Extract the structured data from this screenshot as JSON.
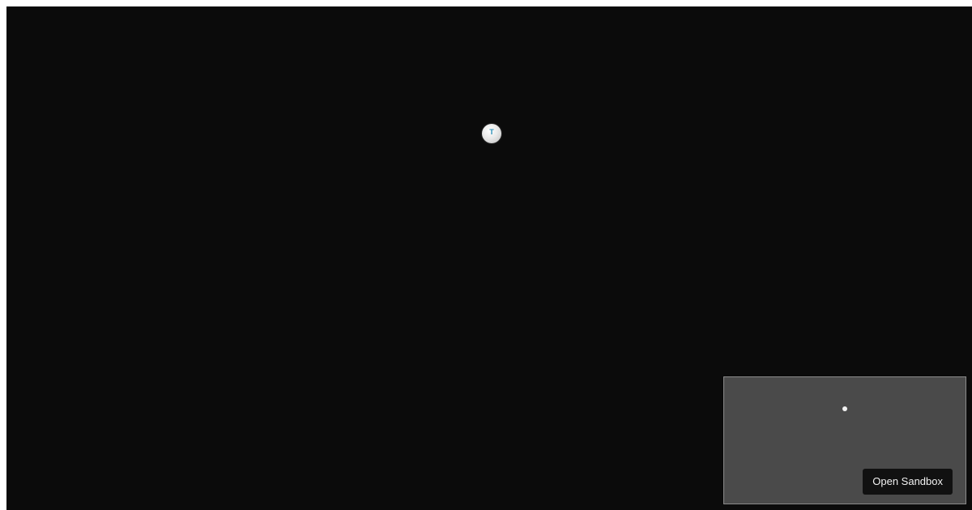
{
  "scene": {
    "background_color": "#0b0b0b",
    "ball": {
      "letter": "T",
      "letter_color": "#2a8fb8"
    }
  },
  "minimap": {
    "background_color": "#4a4a4a",
    "dot_color": "#f2f2f2"
  },
  "actions": {
    "open_sandbox_label": "Open Sandbox"
  }
}
